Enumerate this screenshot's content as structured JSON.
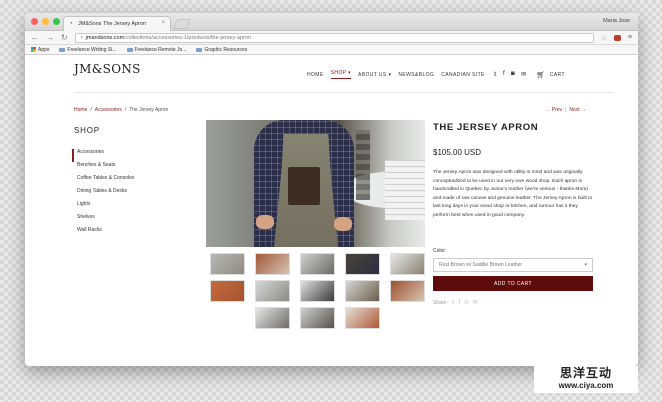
{
  "browser": {
    "tab_title": "JM&Sons The Jersey Apron",
    "user_name": "Maria Jose",
    "url_domain": "jmandsons.com",
    "url_path": "/collections/accessories-1/products/the-jersey-apron",
    "bookmarks": [
      "Apps",
      "Freelance Writing Si...",
      "Freelance Remote Jo...",
      "Graphic Resources"
    ]
  },
  "site": {
    "logo": "JM&SONS",
    "nav": {
      "home": "HOME",
      "shop": "SHOP",
      "about": "ABOUT US",
      "news": "NEWS&BLOG",
      "canadian": "CANADIAN SITE",
      "cart": "CART"
    },
    "breadcrumb": {
      "home": "Home",
      "section": "Accessories",
      "current": "The Jersey Apron"
    },
    "prev": "← Prev",
    "next": "Next →",
    "sidebar": {
      "title": "SHOP",
      "items": [
        "Accessories",
        "Benches & Seats",
        "Coffee Tables & Consoles",
        "Dining Tables & Desks",
        "Lights",
        "Shelves",
        "Wall Racks"
      ]
    },
    "product": {
      "title": "THE JERSEY APRON",
      "price": "$105.00 USD",
      "description": "The Jersey Apron was designed with utility in mind and was originally conceptualized to be used in our very own wood shop. Each apron is handcrafted in Quebec by Junior's mother (we're serious - thanks Mom) and made of raw canvas and genuine leather. The Jersey Apron is built to last long days in your wood shop or kitchen, and rumour has it they perform best when used in good company.",
      "color_label": "Color:",
      "color_value": "Rust Brown w/ Saddle Brown Leather",
      "add_to_cart": "ADD TO CART",
      "share_label": "Share:"
    }
  },
  "watermark": {
    "cn": "思洋互动",
    "url": "www.ciya.com"
  },
  "colors": {
    "accent": "#8b1a1a",
    "button": "#5e0b0b"
  }
}
